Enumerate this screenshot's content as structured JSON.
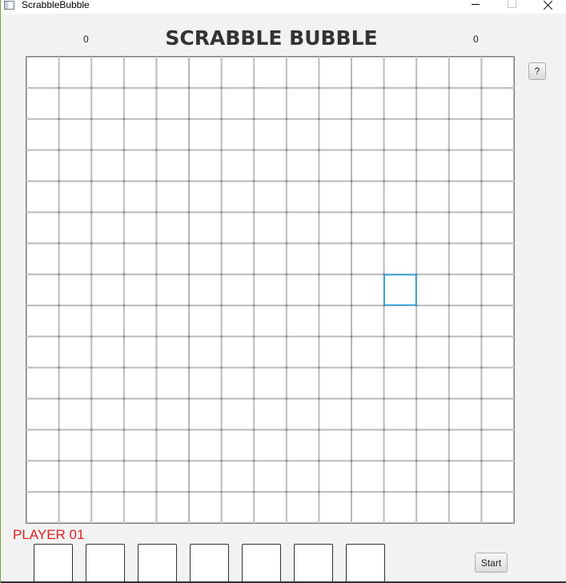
{
  "window": {
    "title": "ScrabbleBubble",
    "icon": "app-window-icon",
    "controls": [
      "minimize-icon",
      "maximize-icon",
      "close-icon"
    ]
  },
  "header": {
    "title": "SCRABBLE BUBBLE",
    "score_left": "0",
    "score_right": "0",
    "help_label": "?"
  },
  "board": {
    "columns": 15,
    "rows": 15,
    "selected_cell": {
      "row": 7,
      "col": 11
    },
    "selection_color": "#1e9bd7",
    "line_color": "#b8b8b8"
  },
  "player": {
    "label": "PLAYER 01",
    "label_color": "#e02020",
    "rack_tiles": [
      "",
      "",
      "",
      "",
      "",
      "",
      ""
    ]
  },
  "controls": {
    "start_label": "Start"
  }
}
